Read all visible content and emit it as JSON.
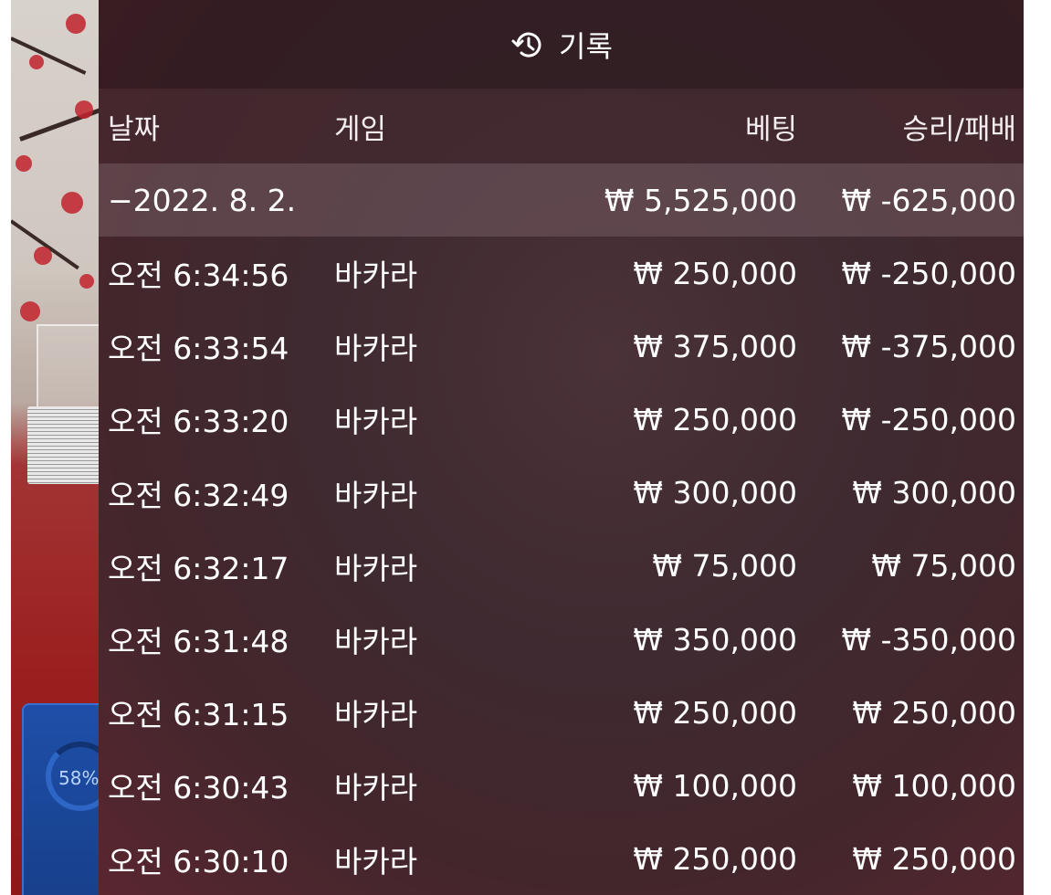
{
  "header": {
    "title": "기록",
    "icon": "history-icon"
  },
  "columns": {
    "date": "날짜",
    "game": "게임",
    "bet": "베팅",
    "result": "승리/패배"
  },
  "date_group": {
    "date": "−2022. 8. 2.",
    "total_bet": "₩ 5,525,000",
    "total_result": "₩ -625,000"
  },
  "rows": [
    {
      "time": "오전 6:34:56",
      "game": "바카라",
      "bet": "₩ 250,000",
      "result": "₩ -250,000"
    },
    {
      "time": "오전 6:33:54",
      "game": "바카라",
      "bet": "₩ 375,000",
      "result": "₩ -375,000"
    },
    {
      "time": "오전 6:33:20",
      "game": "바카라",
      "bet": "₩ 250,000",
      "result": "₩ -250,000"
    },
    {
      "time": "오전 6:32:49",
      "game": "바카라",
      "bet": "₩ 300,000",
      "result": "₩ 300,000"
    },
    {
      "time": "오전 6:32:17",
      "game": "바카라",
      "bet": "₩ 75,000",
      "result": "₩ 75,000"
    },
    {
      "time": "오전 6:31:48",
      "game": "바카라",
      "bet": "₩ 350,000",
      "result": "₩ -350,000"
    },
    {
      "time": "오전 6:31:15",
      "game": "바카라",
      "bet": "₩ 250,000",
      "result": "₩ 250,000"
    },
    {
      "time": "오전 6:30:43",
      "game": "바카라",
      "bet": "₩ 100,000",
      "result": "₩ 100,000"
    },
    {
      "time": "오전 6:30:10",
      "game": "바카라",
      "bet": "₩ 250,000",
      "result": "₩ 250,000"
    }
  ],
  "background": {
    "timer_text": "58%"
  },
  "colors": {
    "panel_bg": "#3e2a30",
    "header_bg": "#2a161c",
    "group_row_bg": "#6e555c",
    "text": "#ffffff"
  }
}
